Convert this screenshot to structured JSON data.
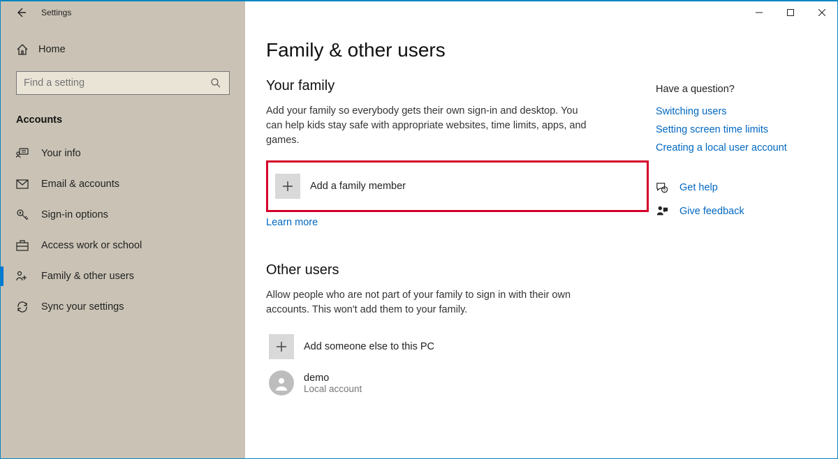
{
  "window": {
    "title": "Settings"
  },
  "sidebar": {
    "home": "Home",
    "search_placeholder": "Find a setting",
    "section": "Accounts",
    "items": [
      {
        "label": "Your info"
      },
      {
        "label": "Email & accounts"
      },
      {
        "label": "Sign-in options"
      },
      {
        "label": "Access work or school"
      },
      {
        "label": "Family & other users"
      },
      {
        "label": "Sync your settings"
      }
    ]
  },
  "main": {
    "title": "Family & other users",
    "family": {
      "heading": "Your family",
      "desc": "Add your family so everybody gets their own sign-in and desktop. You can help kids stay safe with appropriate websites, time limits, apps, and games.",
      "add_label": "Add a family member",
      "learn_more": "Learn more"
    },
    "other": {
      "heading": "Other users",
      "desc": "Allow people who are not part of your family to sign in with their own accounts. This won't add them to your family.",
      "add_label": "Add someone else to this PC",
      "user_name": "demo",
      "user_sub": "Local account"
    }
  },
  "help": {
    "question": "Have a question?",
    "links": [
      "Switching users",
      "Setting screen time limits",
      "Creating a local user account"
    ],
    "get_help": "Get help",
    "feedback": "Give feedback"
  }
}
